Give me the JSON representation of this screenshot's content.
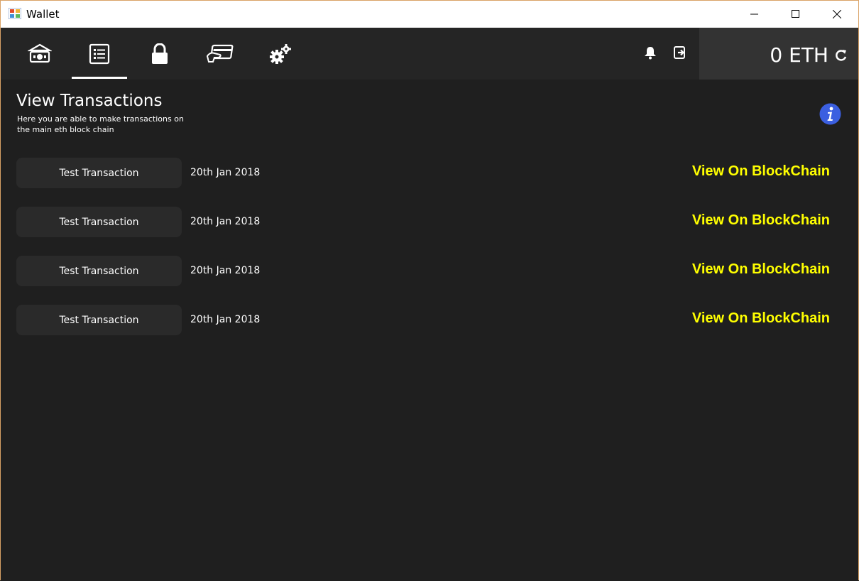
{
  "window": {
    "title": "Wallet"
  },
  "navbar": {
    "items": [
      {
        "name": "bank-icon"
      },
      {
        "name": "transactions-list-icon",
        "active": true
      },
      {
        "name": "lock-icon"
      },
      {
        "name": "card-payment-icon"
      },
      {
        "name": "settings-gears-icon"
      }
    ],
    "tools": [
      {
        "name": "bell-icon"
      },
      {
        "name": "logout-icon"
      }
    ],
    "balance": "0 ETH"
  },
  "page": {
    "title": "View Transactions",
    "subtitle": "Here you are able to make transactions on the main eth block chain"
  },
  "transactions": [
    {
      "label": "Test Transaction",
      "date": "20th Jan 2018",
      "link": "View On BlockChain"
    },
    {
      "label": "Test Transaction",
      "date": "20th Jan 2018",
      "link": "View On BlockChain"
    },
    {
      "label": "Test Transaction",
      "date": "20th Jan 2018",
      "link": "View On BlockChain"
    },
    {
      "label": "Test Transaction",
      "date": "20th Jan 2018",
      "link": "View On BlockChain"
    }
  ],
  "colors": {
    "background": "#1f1f1f",
    "navbar": "#252525",
    "balance_panel": "#333333",
    "row_label": "#2a2a2a",
    "link": "#ffff00",
    "info": "#3b5fe0"
  }
}
